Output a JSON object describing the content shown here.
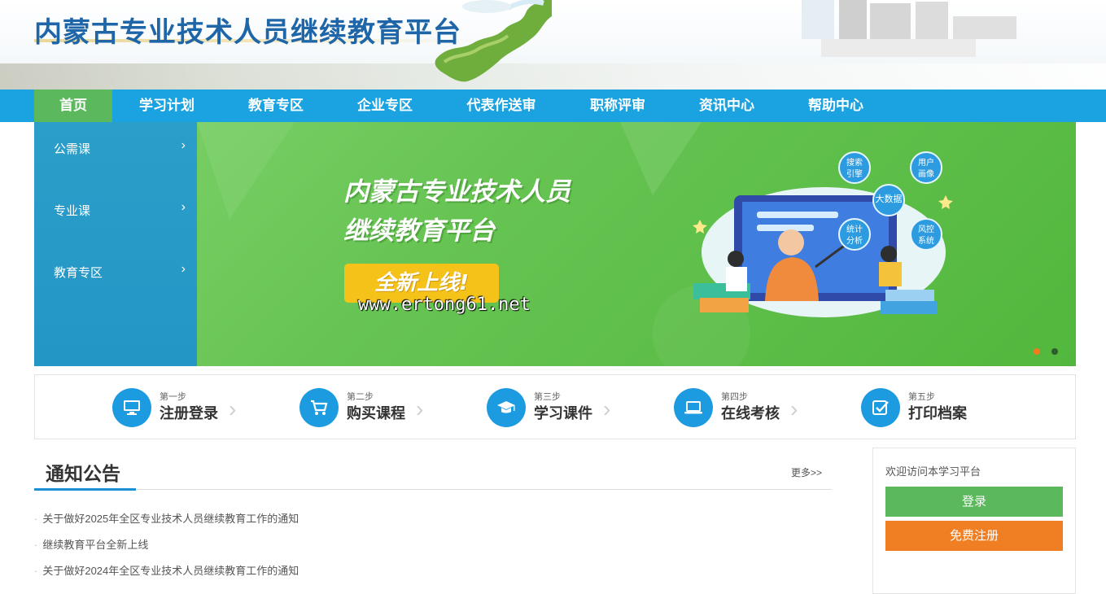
{
  "header": {
    "site_title": "内蒙古专业技术人员继续教育平台"
  },
  "nav": {
    "items": [
      {
        "label": "首页",
        "active": true
      },
      {
        "label": "学习计划",
        "active": false
      },
      {
        "label": "教育专区",
        "active": false
      },
      {
        "label": "企业专区",
        "active": false
      },
      {
        "label": "代表作送审",
        "active": false
      },
      {
        "label": "职称评审",
        "active": false
      },
      {
        "label": "资讯中心",
        "active": false
      },
      {
        "label": "帮助中心",
        "active": false
      }
    ]
  },
  "side_menu": {
    "items": [
      {
        "label": "公需课",
        "arrow": "›"
      },
      {
        "label": "专业课",
        "arrow": "›"
      },
      {
        "label": "教育专区",
        "arrow": "›"
      }
    ]
  },
  "banner": {
    "title_line1": "内蒙古专业技术人员",
    "title_line2": "继续教育平台",
    "badge": "全新上线!",
    "watermark": "www.ertong61.net",
    "bubbles": [
      "搜索\n引擎",
      "用户\n画像",
      "大数据",
      "统计\n分析",
      "风控\n系统"
    ],
    "slides": [
      {
        "color": "#f47920",
        "active": true
      },
      {
        "color": "#2d5d2a",
        "active": false
      }
    ]
  },
  "steps": [
    {
      "no": "第一步",
      "name": "注册登录",
      "icon": "monitor-icon"
    },
    {
      "no": "第二步",
      "name": "购买课程",
      "icon": "cart-icon"
    },
    {
      "no": "第三步",
      "name": "学习课件",
      "icon": "graduation-cap-icon"
    },
    {
      "no": "第四步",
      "name": "在线考核",
      "icon": "laptop-icon"
    },
    {
      "no": "第五步",
      "name": "打印档案",
      "icon": "checkbox-icon"
    }
  ],
  "steps_chevron": "›",
  "notice": {
    "title": "通知公告",
    "more": "更多>>",
    "items": [
      "关于做好2025年全区专业技术人员继续教育工作的通知",
      "继续教育平台全新上线",
      "关于做好2024年全区专业技术人员继续教育工作的通知"
    ]
  },
  "login": {
    "welcome": "欢迎访问本学习平台",
    "login_label": "登录",
    "register_label": "免费注册"
  },
  "colors": {
    "nav_bg": "#1aa3e0",
    "nav_active": "#5cb85c",
    "title_blue": "#1e66a8",
    "login_green": "#5cb85c",
    "register_orange": "#f07f23"
  }
}
